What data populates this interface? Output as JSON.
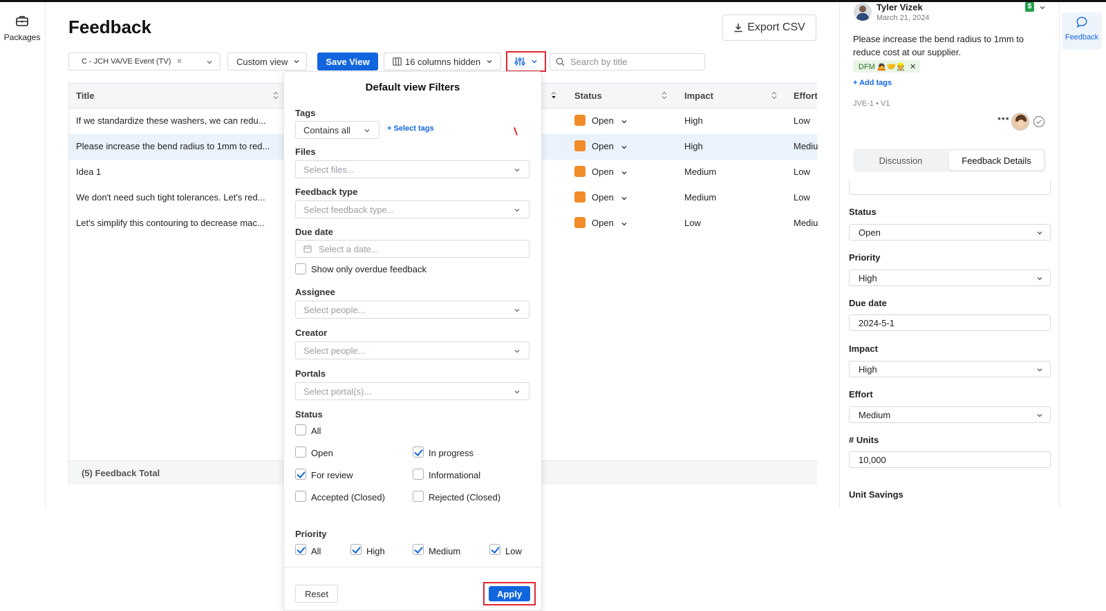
{
  "left_rail": {
    "packages_label": "Packages",
    "packages_icon": "briefcase-icon"
  },
  "page": {
    "title": "Feedback",
    "export_label": "Export CSV"
  },
  "toolbar": {
    "package_chip": "C - JCH VA/VE Event (TV)",
    "view_select": "Custom view",
    "save_view": "Save View",
    "columns_hidden": "16 columns hidden",
    "search_placeholder": "Search by title"
  },
  "table": {
    "columns": [
      "Title",
      "Status",
      "Impact",
      "Effort"
    ],
    "rows": [
      {
        "title": "If we standardize these washers, we can redu...",
        "status": "Open",
        "impact": "High",
        "effort": "Low"
      },
      {
        "title": "Please increase the bend radius to 1mm to red...",
        "status": "Open",
        "impact": "High",
        "effort": "Mediu"
      },
      {
        "title": "Idea 1",
        "status": "Open",
        "impact": "Medium",
        "effort": "Low"
      },
      {
        "title": "We don't need such tight tolerances. Let's red...",
        "status": "Open",
        "impact": "Medium",
        "effort": "Low"
      },
      {
        "title": "Let's simplify this contouring to decrease mac...",
        "status": "Open",
        "impact": "Low",
        "effort": "Mediu"
      }
    ],
    "footer": "(5) Feedback Total"
  },
  "filters": {
    "title": "Default view Filters",
    "tags_label": "Tags",
    "tags_mode": "Contains all",
    "select_tags": "Select tags",
    "files_label": "Files",
    "files_placeholder": "Select files...",
    "type_label": "Feedback type",
    "type_placeholder": "Select feedback type...",
    "due_label": "Due date",
    "due_placeholder": "Select a date...",
    "overdue_label": "Show only overdue feedback",
    "assignee_label": "Assignee",
    "assignee_placeholder": "Select people...",
    "creator_label": "Creator",
    "creator_placeholder": "Select people...",
    "portals_label": "Portals",
    "portals_placeholder": "Select portal(s)...",
    "status_label": "Status",
    "status_options": [
      {
        "label": "All",
        "checked": false
      },
      {
        "label": "Open",
        "checked": false
      },
      {
        "label": "In progress",
        "checked": true
      },
      {
        "label": "For review",
        "checked": true
      },
      {
        "label": "Informational",
        "checked": false
      },
      {
        "label": "Accepted (Closed)",
        "checked": false
      },
      {
        "label": "Rejected (Closed)",
        "checked": false
      }
    ],
    "priority_label": "Priority",
    "priority_options": [
      {
        "label": "All",
        "checked": true
      },
      {
        "label": "High",
        "checked": true
      },
      {
        "label": "Medium",
        "checked": true
      },
      {
        "label": "Low",
        "checked": true
      }
    ],
    "reset": "Reset",
    "apply": "Apply"
  },
  "detail": {
    "author": "Tyler Vizek",
    "date": "March 21, 2024",
    "badge": "$",
    "body": "Please increase the bend radius to 1mm to reduce cost at our supplier.",
    "tag": "DFM 🙇🤝👷",
    "add_tags": "Add tags",
    "ref": "JVE-1",
    "version": "V1",
    "tab_discussion": "Discussion",
    "tab_details": "Feedback Details",
    "status_label": "Status",
    "status_value": "Open",
    "priority_label": "Priority",
    "priority_value": "High",
    "due_label": "Due date",
    "due_value": "2024-5-1",
    "impact_label": "Impact",
    "impact_value": "High",
    "effort_label": "Effort",
    "effort_value": "Medium",
    "units_label": "# Units",
    "units_value": "10,000",
    "savings_label": "Unit Savings"
  },
  "right_rail": {
    "feedback_label": "Feedback",
    "icon": "chat-bubble-icon"
  },
  "colors": {
    "primary": "#1166dd",
    "status_open": "#f28c28",
    "highlight": "#e3262f"
  }
}
